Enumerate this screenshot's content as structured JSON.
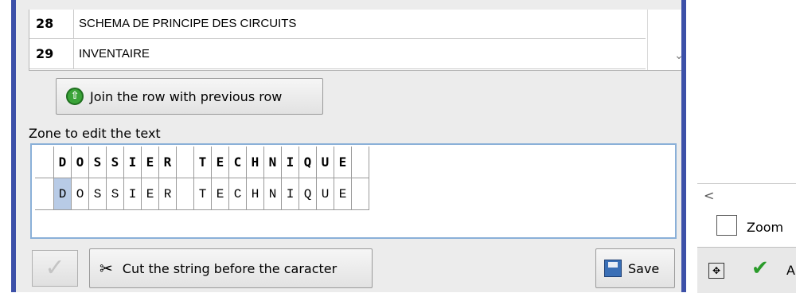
{
  "table": {
    "rows": [
      {
        "num": "28",
        "text": "SCHEMA DE PRINCIPE DES CIRCUITS"
      },
      {
        "num": "29",
        "text": "INVENTAIRE"
      }
    ]
  },
  "join_button": {
    "label": "Join the row with previous row",
    "icon": "arrow-up-circle-icon"
  },
  "zone": {
    "label": "Zone to edit the text",
    "row_reference": [
      "D",
      "O",
      "S",
      "S",
      "I",
      "E",
      "R",
      "",
      "T",
      "E",
      "C",
      "H",
      "N",
      "I",
      "Q",
      "U",
      "E",
      ""
    ],
    "row_edit": [
      "D",
      "O",
      "S",
      "S",
      "I",
      "E",
      "R",
      "",
      "T",
      "E",
      "C",
      "H",
      "N",
      "I",
      "Q",
      "U",
      "E",
      ""
    ],
    "selected_index": 0
  },
  "bottom": {
    "cut_label": "Cut the string before the caracter",
    "save_label": "Save"
  },
  "right_panel": {
    "arrow": "<",
    "zoom_label": "Zoom",
    "partial_label": "A"
  },
  "colors": {
    "accent_stripe": "#3c50a8",
    "selection": "#b8cbe6",
    "zone_border": "#8ab0d8"
  }
}
